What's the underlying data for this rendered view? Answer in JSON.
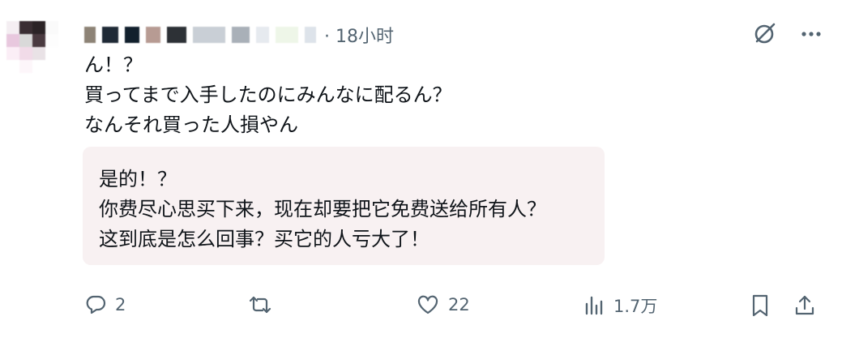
{
  "post": {
    "author_name": "",
    "time": "· 18小时",
    "text": "ん！？\n買ってまで入手したのにみんなに配るん？\nなんそれ買った人損やん"
  },
  "translation": {
    "text": "是的！？\n你费尽心思买下来，现在却要把它免费送给所有人？\n这到底是怎么回事？买它的人亏大了！"
  },
  "actions": {
    "reply_count": "2",
    "repost_count": "",
    "like_count": "22",
    "views_count": "1.7万"
  },
  "icons": {
    "grok": "slashed-circle-icon",
    "more": "more-icon",
    "reply": "reply-icon",
    "repost": "repost-icon",
    "like": "like-icon",
    "views": "views-icon",
    "bookmark": "bookmark-icon",
    "share": "share-icon"
  },
  "colors": {
    "text": "#0f1419",
    "muted": "#536471",
    "translation_bg": "#f8f1f2"
  }
}
